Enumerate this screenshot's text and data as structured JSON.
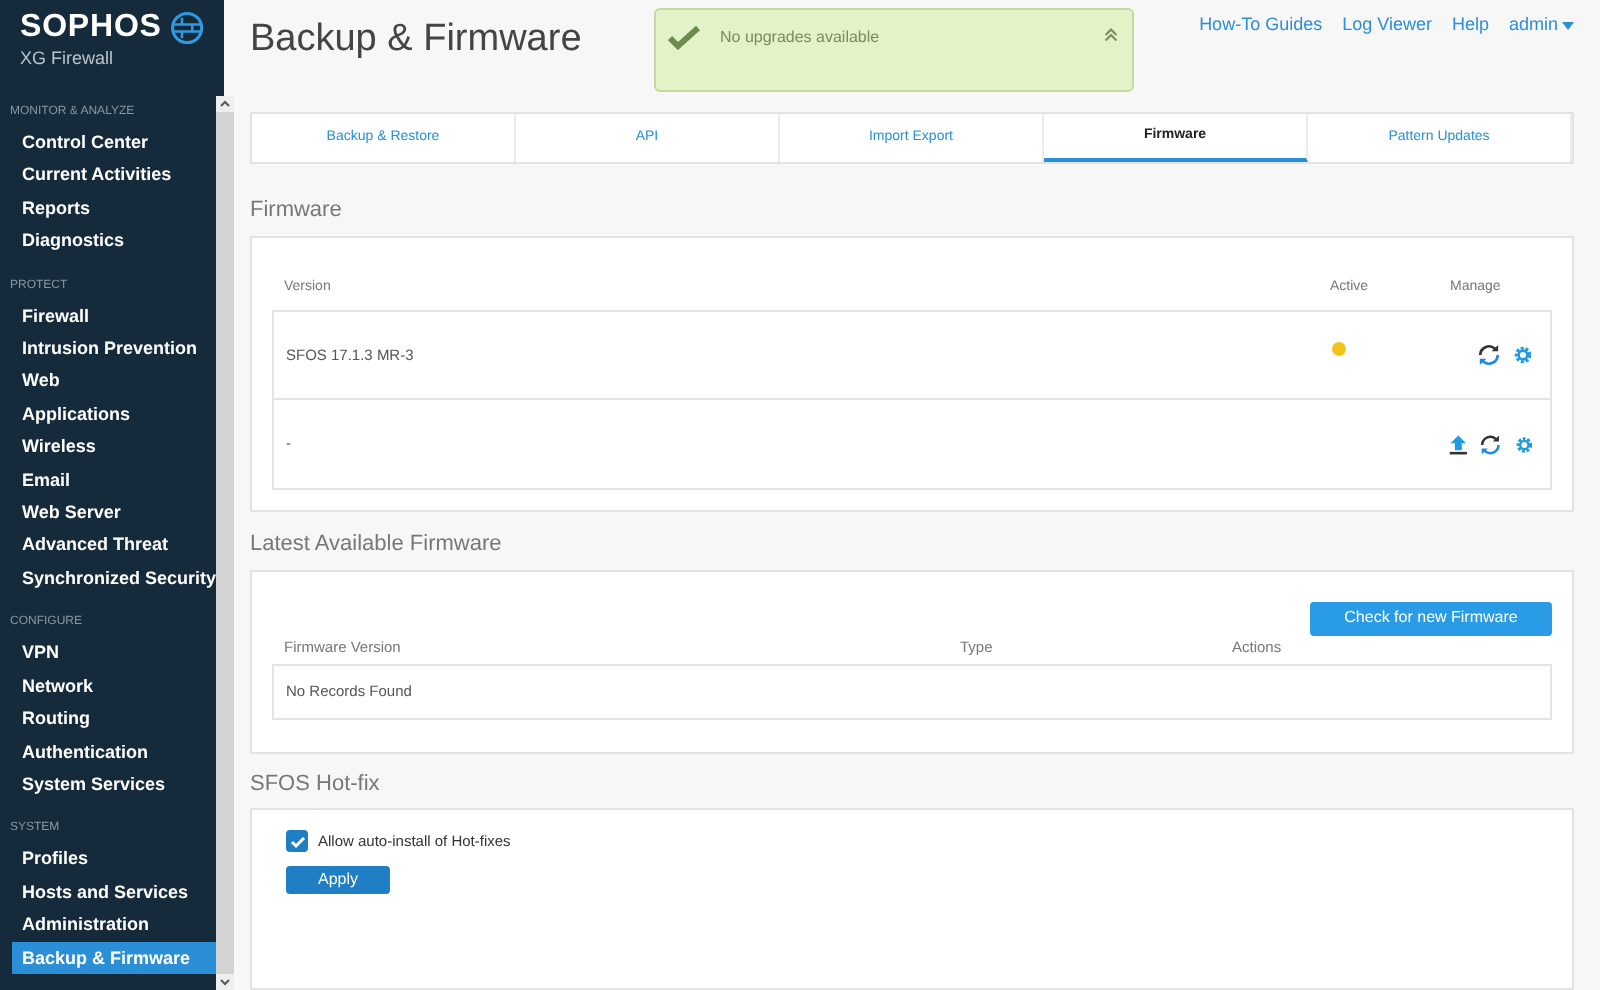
{
  "logo": {
    "brand": "SOPHOS",
    "product": "XG Firewall"
  },
  "sidebar": {
    "sections": [
      {
        "label": "MONITOR & ANALYZE",
        "items": [
          {
            "label": "Control Center",
            "selected": false
          },
          {
            "label": "Current Activities",
            "selected": false
          },
          {
            "label": "Reports",
            "selected": false
          },
          {
            "label": "Diagnostics",
            "selected": false
          }
        ]
      },
      {
        "label": "PROTECT",
        "items": [
          {
            "label": "Firewall",
            "selected": false
          },
          {
            "label": "Intrusion Prevention",
            "selected": false
          },
          {
            "label": "Web",
            "selected": false
          },
          {
            "label": "Applications",
            "selected": false
          },
          {
            "label": "Wireless",
            "selected": false
          },
          {
            "label": "Email",
            "selected": false
          },
          {
            "label": "Web Server",
            "selected": false
          },
          {
            "label": "Advanced Threat",
            "selected": false
          },
          {
            "label": "Synchronized Security",
            "selected": false
          }
        ]
      },
      {
        "label": "CONFIGURE",
        "items": [
          {
            "label": "VPN",
            "selected": false
          },
          {
            "label": "Network",
            "selected": false
          },
          {
            "label": "Routing",
            "selected": false
          },
          {
            "label": "Authentication",
            "selected": false
          },
          {
            "label": "System Services",
            "selected": false
          }
        ]
      },
      {
        "label": "SYSTEM",
        "items": [
          {
            "label": "Profiles",
            "selected": false
          },
          {
            "label": "Hosts and Services",
            "selected": false
          },
          {
            "label": "Administration",
            "selected": false
          },
          {
            "label": "Backup & Firmware",
            "selected": true
          }
        ]
      }
    ]
  },
  "header": {
    "title": "Backup & Firmware",
    "links": [
      "How-To Guides",
      "Log Viewer",
      "Help"
    ],
    "user": "admin"
  },
  "toast": {
    "message": "No upgrades available"
  },
  "tabs": [
    {
      "label": "Backup & Restore",
      "selected": false
    },
    {
      "label": "API",
      "selected": false
    },
    {
      "label": "Import Export",
      "selected": false
    },
    {
      "label": "Firmware",
      "selected": true
    },
    {
      "label": "Pattern Updates",
      "selected": false
    }
  ],
  "firmware": {
    "heading": "Firmware",
    "columns": [
      "Version",
      "Active",
      "Manage"
    ],
    "rows": [
      {
        "version": "SFOS 17.1.3 MR-3",
        "active": true,
        "actions": [
          {
            "kind": "refresh"
          },
          {
            "kind": "settings"
          }
        ]
      },
      {
        "version": "-",
        "active": false,
        "actions": [
          {
            "kind": "upload"
          },
          {
            "kind": "refresh"
          },
          {
            "kind": "settings"
          }
        ]
      }
    ]
  },
  "latest": {
    "heading": "Latest Available Firmware",
    "button": "Check for new Firmware",
    "columns": [
      "Firmware Version",
      "Type",
      "Actions"
    ],
    "empty": "No Records Found"
  },
  "hotfix": {
    "heading": "SFOS Hot-fix",
    "checkbox": {
      "label": "Allow auto-install of Hot-fixes",
      "checked": true
    },
    "button": "Apply"
  }
}
